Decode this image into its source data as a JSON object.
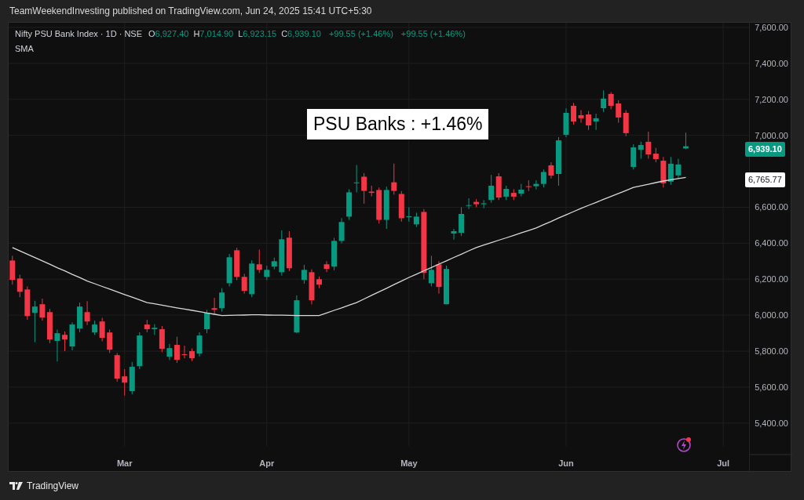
{
  "attribution": "TeamWeekendInvesting published on TradingView.com, Jun 24, 2025 15:41 UTC+5:30",
  "legend": {
    "symbol": "Nifty PSU Bank Index · 1D · NSE",
    "open_label": "O",
    "open": "6,927.40",
    "high_label": "H",
    "high": "7,014.90",
    "low_label": "L",
    "low": "6,923.15",
    "close_label": "C",
    "close": "6,939.10",
    "change": "+99.55 (+1.46%)",
    "change_2": "+99.55 (+1.46%)"
  },
  "annotation": "PSU Banks : +1.46%",
  "price_badges": {
    "last_price": "6,939.10",
    "sma_value": "6,765.77"
  },
  "chart_data": {
    "type": "candlestick",
    "grid": true,
    "ylim": [
      5125,
      7626
    ],
    "categories": [
      null,
      null,
      null,
      null,
      null,
      null,
      null,
      null,
      null,
      null,
      null,
      null,
      null,
      null,
      null,
      "Mar",
      null,
      null,
      null,
      null,
      null,
      null,
      null,
      null,
      null,
      null,
      null,
      null,
      null,
      null,
      null,
      null,
      null,
      null,
      "Apr",
      null,
      null,
      null,
      null,
      null,
      null,
      null,
      null,
      null,
      null,
      null,
      null,
      null,
      null,
      null,
      null,
      null,
      null,
      "May",
      null,
      null,
      null,
      null,
      null,
      null,
      null,
      null,
      null,
      null,
      null,
      null,
      null,
      null,
      null,
      null,
      null,
      null,
      null,
      null,
      "Jun",
      null,
      null,
      null,
      null,
      null,
      null,
      null,
      null,
      null,
      null,
      null,
      null,
      null,
      null,
      null,
      null,
      null,
      null,
      null,
      null,
      "Jul",
      null,
      null,
      null
    ],
    "ohlc": [
      [
        6304,
        6330,
        6170,
        6196
      ],
      [
        6204,
        6225,
        6100,
        6130
      ],
      [
        6143,
        6160,
        5975,
        5995
      ],
      [
        6013,
        6080,
        5850,
        6048
      ],
      [
        6061,
        6092,
        5970,
        5987
      ],
      [
        6017,
        6035,
        5845,
        5865
      ],
      [
        5857,
        5920,
        5743,
        5900
      ],
      [
        5891,
        5910,
        5800,
        5865
      ],
      [
        5826,
        5960,
        5805,
        5948
      ],
      [
        5926,
        6070,
        5905,
        6048
      ],
      [
        6017,
        6078,
        5945,
        5965
      ],
      [
        5904,
        5970,
        5890,
        5948
      ],
      [
        5965,
        5985,
        5855,
        5874
      ],
      [
        5904,
        5920,
        5790,
        5808
      ],
      [
        5778,
        5790,
        5630,
        5647
      ],
      [
        5660,
        5700,
        5553,
        5625
      ],
      [
        5578,
        5740,
        5560,
        5713
      ],
      [
        5717,
        5905,
        5700,
        5887
      ],
      [
        5948,
        5974,
        5905,
        5922
      ],
      [
        5922,
        5950,
        5890,
        5930
      ],
      [
        5922,
        5940,
        5795,
        5813
      ],
      [
        5769,
        5840,
        5750,
        5817
      ],
      [
        5835,
        5880,
        5735,
        5752
      ],
      [
        5783,
        5830,
        5760,
        5780
      ],
      [
        5800,
        5815,
        5745,
        5761
      ],
      [
        5787,
        5905,
        5770,
        5887
      ],
      [
        5922,
        6030,
        5900,
        6013
      ],
      [
        6039,
        6096,
        6009,
        6030
      ],
      [
        6039,
        6150,
        6020,
        6126
      ],
      [
        6178,
        6340,
        6160,
        6322
      ],
      [
        6361,
        6375,
        6195,
        6213
      ],
      [
        6213,
        6230,
        6120,
        6135
      ],
      [
        6117,
        6305,
        6100,
        6287
      ],
      [
        6283,
        6365,
        6235,
        6252
      ],
      [
        6213,
        6275,
        6195,
        6252
      ],
      [
        6270,
        6320,
        6255,
        6300
      ],
      [
        6239,
        6471,
        6220,
        6422
      ],
      [
        6431,
        6467,
        6245,
        6261
      ],
      [
        5904,
        6110,
        5900,
        6083
      ],
      [
        6196,
        6280,
        6175,
        6252
      ],
      [
        6239,
        6255,
        6060,
        6083
      ],
      [
        6200,
        6215,
        6150,
        6170
      ],
      [
        6283,
        6300,
        6240,
        6257
      ],
      [
        6270,
        6430,
        6250,
        6413
      ],
      [
        6413,
        6540,
        6400,
        6518
      ],
      [
        6548,
        6700,
        6530,
        6683
      ],
      [
        6735,
        6835,
        6683,
        6738
      ],
      [
        6770,
        6790,
        6620,
        6691
      ],
      [
        6687,
        6720,
        6660,
        6680
      ],
      [
        6696,
        6710,
        6510,
        6530
      ],
      [
        6530,
        6715,
        6480,
        6696
      ],
      [
        6739,
        6843,
        6670,
        6691
      ],
      [
        6674,
        6690,
        6520,
        6539
      ],
      [
        6545,
        6600,
        6520,
        6550
      ],
      [
        6505,
        6570,
        6490,
        6548
      ],
      [
        6574,
        6590,
        6200,
        6235
      ],
      [
        6178,
        6330,
        6160,
        6252
      ],
      [
        6283,
        6300,
        6120,
        6157
      ],
      [
        6061,
        6275,
        6060,
        6257
      ],
      [
        6454,
        6480,
        6420,
        6467
      ],
      [
        6458,
        6600,
        6440,
        6563
      ],
      [
        6609,
        6650,
        6590,
        6612
      ],
      [
        6630,
        6645,
        6600,
        6617
      ],
      [
        6617,
        6640,
        6595,
        6622
      ],
      [
        6641,
        6780,
        6625,
        6720
      ],
      [
        6772,
        6790,
        6640,
        6654
      ],
      [
        6659,
        6720,
        6640,
        6702
      ],
      [
        6680,
        6700,
        6640,
        6659
      ],
      [
        6676,
        6730,
        6660,
        6698
      ],
      [
        6717,
        6750,
        6690,
        6713
      ],
      [
        6717,
        6750,
        6700,
        6730
      ],
      [
        6730,
        6810,
        6710,
        6796
      ],
      [
        6833,
        6850,
        6760,
        6776
      ],
      [
        6785,
        6990,
        6720,
        6972
      ],
      [
        7003,
        7150,
        6990,
        7125
      ],
      [
        7164,
        7180,
        7060,
        7077
      ],
      [
        7112,
        7140,
        7070,
        7095
      ],
      [
        7116,
        7135,
        7030,
        7055
      ],
      [
        7077,
        7120,
        7030,
        7095
      ],
      [
        7151,
        7250,
        7130,
        7204
      ],
      [
        7230,
        7240,
        7145,
        7164
      ],
      [
        7177,
        7195,
        7070,
        7099
      ],
      [
        7125,
        7140,
        6995,
        7012
      ],
      [
        6824,
        6950,
        6810,
        6933
      ],
      [
        6920,
        6965,
        6870,
        6946
      ],
      [
        6964,
        7020,
        6870,
        6894
      ],
      [
        6898,
        6930,
        6850,
        6868
      ],
      [
        6859,
        6880,
        6710,
        6733
      ],
      [
        6742,
        6880,
        6725,
        6842
      ],
      [
        6777,
        6870,
        6760,
        6838
      ],
      [
        6927,
        7015,
        6923,
        6939
      ],
      null,
      null,
      null,
      null,
      null,
      null,
      null,
      null
    ],
    "yticks": [
      {
        "value": 7600,
        "label": "7,600.00"
      },
      {
        "value": 7400,
        "label": "7,400.00"
      },
      {
        "value": 7200,
        "label": "7,200.00"
      },
      {
        "value": 7000,
        "label": "7,000.00"
      },
      {
        "value": 6600,
        "label": "6,600.00"
      },
      {
        "value": 6400,
        "label": "6,400.00"
      },
      {
        "value": 6200,
        "label": "6,200.00"
      },
      {
        "value": 6000,
        "label": "6,000.00"
      },
      {
        "value": 5800,
        "label": "5,800.00"
      },
      {
        "value": 5600,
        "label": "5,600.00"
      },
      {
        "value": 5400,
        "label": "5,400.00"
      }
    ],
    "series": [
      {
        "name": "SMA",
        "type": "line",
        "color": "#d9d9d9",
        "values": [
          6376,
          6357,
          6339,
          6320,
          6302,
          6283,
          6264,
          6246,
          6227,
          6209,
          6190,
          6175,
          6160,
          6145,
          6130,
          6115,
          6100,
          6085,
          6070,
          6063,
          6056,
          6048,
          6041,
          6034,
          6027,
          6020,
          6012,
          6005,
          5998,
          5999,
          6000,
          6001,
          6002,
          6002,
          6001,
          6000,
          6000,
          5999,
          5998,
          5998,
          5998,
          5998,
          6012,
          6027,
          6041,
          6056,
          6070,
          6090,
          6110,
          6130,
          6150,
          6170,
          6190,
          6210,
          6228,
          6247,
          6265,
          6284,
          6302,
          6321,
          6339,
          6358,
          6376,
          6390,
          6403,
          6417,
          6430,
          6444,
          6458,
          6471,
          6485,
          6503,
          6521,
          6540,
          6558,
          6576,
          6594,
          6611,
          6627,
          6644,
          6660,
          6677,
          6693,
          6710,
          6719,
          6728,
          6737,
          6746,
          6753,
          6760,
          6766,
          null,
          null,
          null,
          null,
          null,
          null,
          null,
          null
        ]
      }
    ]
  },
  "footer": {
    "logo_text": "TradingView"
  }
}
